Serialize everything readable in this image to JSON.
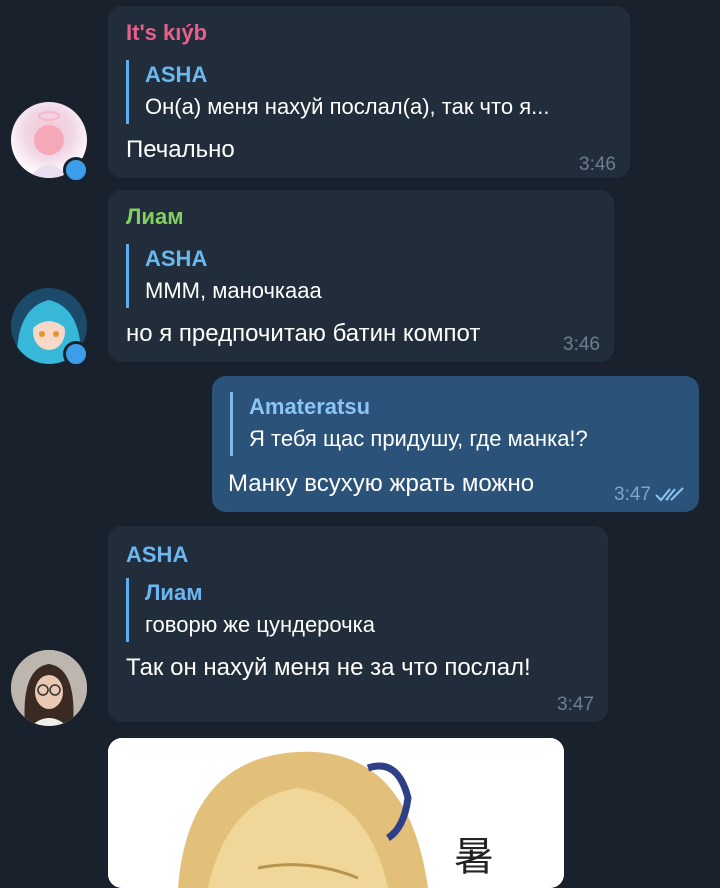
{
  "messages": [
    {
      "sender": "It's kıýb",
      "sender_color": "#e8608a",
      "reply_name": "ASHA",
      "reply_text": "Он(а) меня нахуй послал(а), так что я...",
      "text": "Печально",
      "time": "3:46"
    },
    {
      "sender": "Лиам",
      "sender_color": "#82d05f",
      "reply_name": "ASHA",
      "reply_text": "МММ, маночкааа",
      "text": "но я предпочитаю батин компот",
      "time": "3:46"
    },
    {
      "outgoing": true,
      "reply_name": "Amateratsu",
      "reply_text": "Я тебя щас придушу, где манка!?",
      "text": "Манку всухую жрать можно",
      "time": "3:47",
      "status_icon": "double-check-icon"
    },
    {
      "sender": "ASHA",
      "sender_color": "#6ab7f2",
      "reply_name": "Лиам",
      "reply_text": "говорю же цундерочка",
      "text": "Так он нахуй меня не за что послал!",
      "time": "3:47"
    }
  ],
  "image_glyph": "暑",
  "colors": {
    "background": "#18212c",
    "incoming_bubble": "#212d3b",
    "outgoing_bubble": "#2b5278",
    "accent": "#3c9de8"
  }
}
